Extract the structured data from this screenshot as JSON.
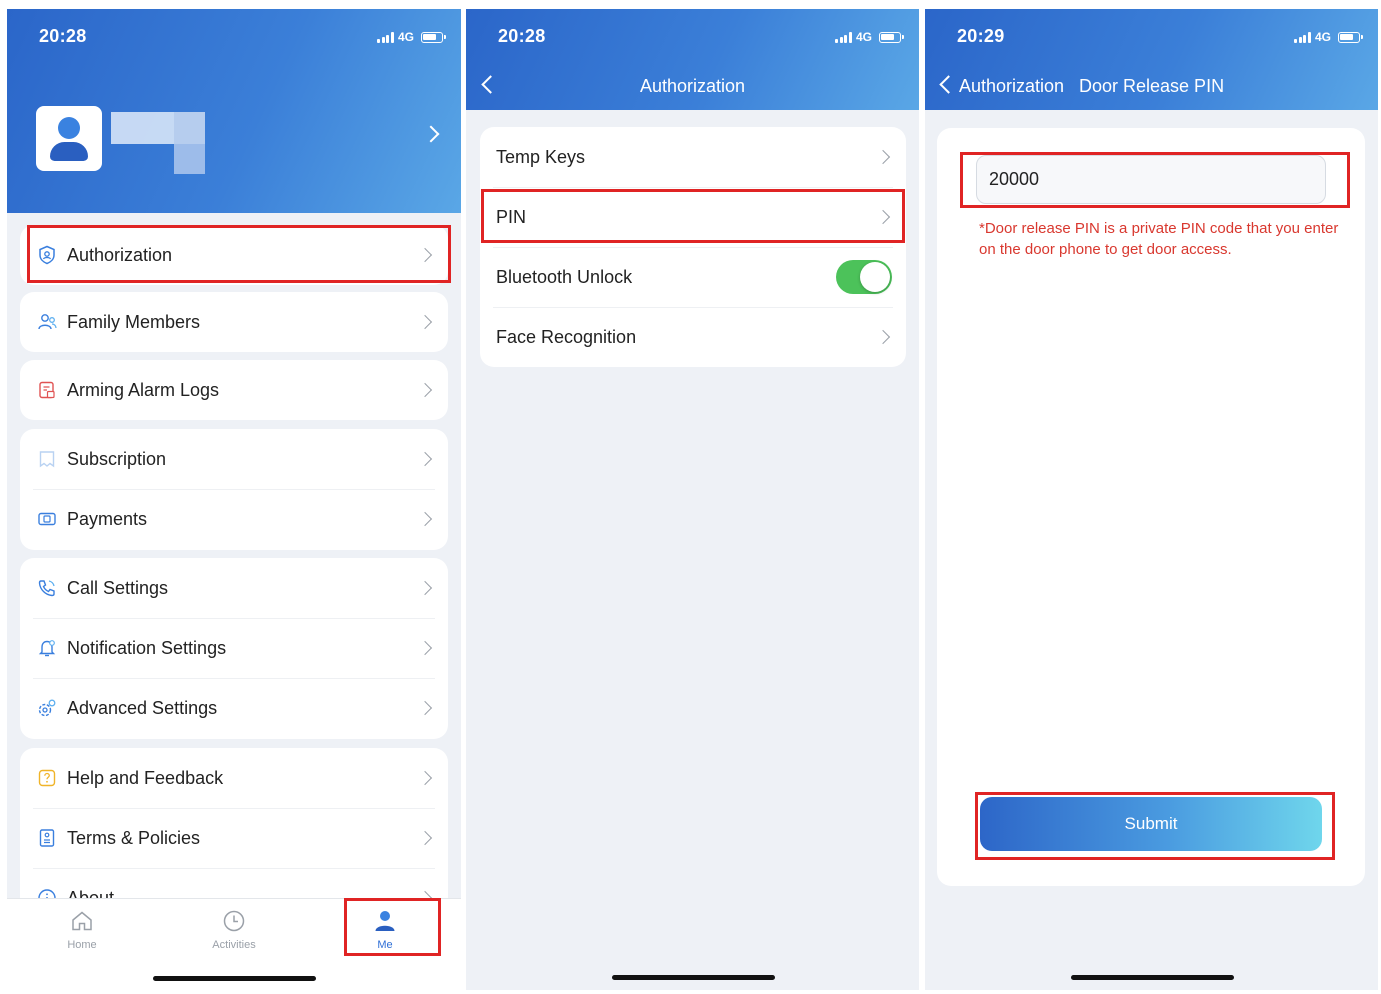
{
  "screen1": {
    "status": {
      "time": "20:28",
      "network": "4G"
    },
    "menu": {
      "authorization": "Authorization",
      "family_members": "Family Members",
      "arming_alarm_logs": "Arming Alarm Logs",
      "subscription": "Subscription",
      "payments": "Payments",
      "call_settings": "Call Settings",
      "notification_settings": "Notification Settings",
      "advanced_settings": "Advanced Settings",
      "help_and_feedback": "Help and Feedback",
      "terms_and_policies": "Terms & Policies",
      "about": "About"
    },
    "tabs": {
      "home": "Home",
      "activities": "Activities",
      "me": "Me"
    }
  },
  "screen2": {
    "status": {
      "time": "20:28",
      "network": "4G"
    },
    "title": "Authorization",
    "items": {
      "temp_keys": "Temp Keys",
      "pin": "PIN",
      "bluetooth_unlock": "Bluetooth Unlock",
      "face_recognition": "Face Recognition"
    },
    "bluetooth_enabled": true
  },
  "screen3": {
    "status": {
      "time": "20:29",
      "network": "4G"
    },
    "back_label": "Authorization",
    "title": "Door Release PIN",
    "pin_value": "20000",
    "note": "*Door release PIN is a private PIN code that you enter on the door phone to get door access.",
    "submit_label": "Submit"
  },
  "colors": {
    "brand_blue": "#2b66c9",
    "highlight": "#e02424",
    "toggle_on": "#4cc25a",
    "note_red": "#d9382f"
  }
}
